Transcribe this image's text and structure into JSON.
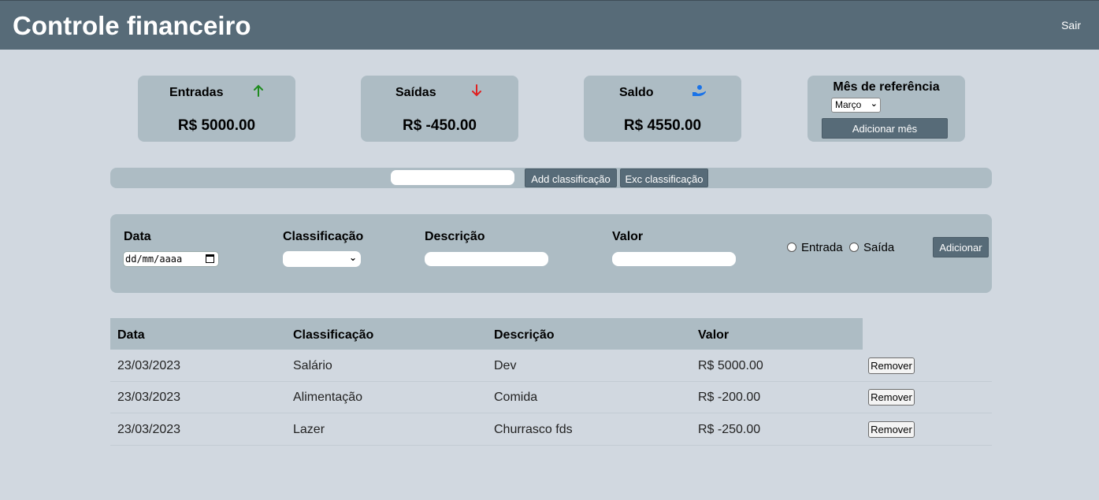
{
  "header": {
    "title": "Controle financeiro",
    "logout_label": "Sair"
  },
  "summary": {
    "income": {
      "label": "Entradas",
      "value": "R$ 5000.00",
      "icon": "arrow-up-icon",
      "color": "#1e8c1e"
    },
    "expenses": {
      "label": "Saídas",
      "value": "R$ -450.00",
      "icon": "arrow-down-icon",
      "color": "#e02020"
    },
    "balance": {
      "label": "Saldo",
      "value": "R$ 4550.00",
      "icon": "money-hand-icon",
      "color": "#1a73e8"
    },
    "month": {
      "label": "Mês de referência",
      "selected": "Março",
      "add_button": "Adicionar mês"
    }
  },
  "classification_bar": {
    "input_value": "",
    "add_button": "Add classificação",
    "delete_button": "Exc classificação"
  },
  "form": {
    "date_label": "Data",
    "date_placeholder": "dd/mm/aaaa",
    "classification_label": "Classificação",
    "classification_selected": "",
    "description_label": "Descrição",
    "description_value": "",
    "value_label": "Valor",
    "value_value": "",
    "radio_income": "Entrada",
    "radio_expense": "Saída",
    "add_button": "Adicionar"
  },
  "table": {
    "headers": [
      "Data",
      "Classificação",
      "Descrição",
      "Valor"
    ],
    "remove_label": "Remover",
    "rows": [
      [
        "23/03/2023",
        "Salário",
        "Dev",
        "R$ 5000.00"
      ],
      [
        "23/03/2023",
        "Alimentação",
        "Comida",
        "R$ -200.00"
      ],
      [
        "23/03/2023",
        "Lazer",
        "Churrasco fds",
        "R$ -250.00"
      ]
    ]
  }
}
